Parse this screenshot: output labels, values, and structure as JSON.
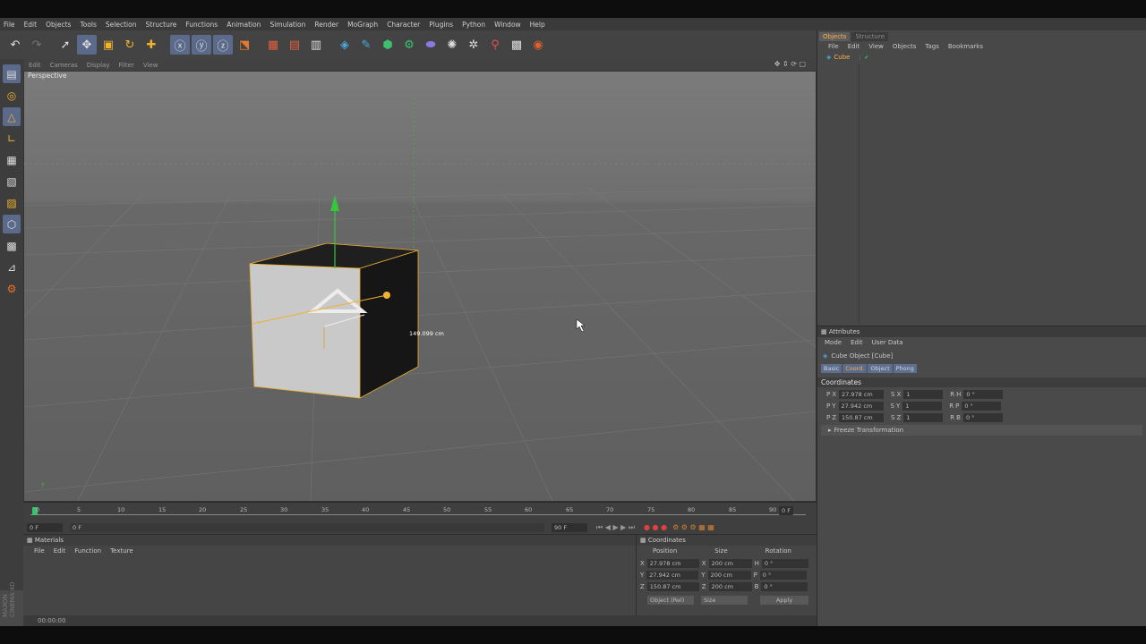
{
  "menu": [
    "File",
    "Edit",
    "Objects",
    "Tools",
    "Selection",
    "Structure",
    "Functions",
    "Animation",
    "Simulation",
    "Render",
    "MoGraph",
    "Character",
    "Plugins",
    "Python",
    "Window",
    "Help"
  ],
  "viewport": {
    "menu": [
      "Edit",
      "Cameras",
      "Display",
      "Filter",
      "View"
    ],
    "label": "Perspective",
    "measure": "149.099 cm"
  },
  "timeline": {
    "ticks": [
      "0",
      "5",
      "10",
      "15",
      "20",
      "25",
      "30",
      "35",
      "40",
      "45",
      "50",
      "55",
      "60",
      "65",
      "70",
      "75",
      "80",
      "85",
      "90"
    ],
    "end_field": "0 F",
    "start_field": "0 F",
    "slider_field": "0 F",
    "max_field": "90 F"
  },
  "materials": {
    "title": "Materials",
    "menu": [
      "File",
      "Edit",
      "Function",
      "Texture"
    ]
  },
  "coordinates": {
    "title": "Coordinates",
    "headers": [
      "Position",
      "Size",
      "Rotation"
    ],
    "rows": [
      {
        "axis": "X",
        "pos": "27.978 cm",
        "size_axis": "X",
        "size": "200 cm",
        "rot_axis": "H",
        "rot": "0 °"
      },
      {
        "axis": "Y",
        "pos": "27.942 cm",
        "size_axis": "Y",
        "size": "200 cm",
        "rot_axis": "P",
        "rot": "0 °"
      },
      {
        "axis": "Z",
        "pos": "150.87 cm",
        "size_axis": "Z",
        "size": "200 cm",
        "rot_axis": "B",
        "rot": "0 °"
      }
    ],
    "mode_select": "Object (Rel)",
    "size_select": "Size",
    "apply": "Apply"
  },
  "status": "00:00:00",
  "object_manager": {
    "tabs": [
      "Objects",
      "Structure"
    ],
    "menu": [
      "File",
      "Edit",
      "View",
      "Objects",
      "Tags",
      "Bookmarks"
    ],
    "objects": [
      {
        "name": "Cube"
      }
    ]
  },
  "attributes": {
    "title": "Attributes",
    "menu": [
      "Mode",
      "Edit",
      "User Data"
    ],
    "object_title": "Cube Object [Cube]",
    "tabs": [
      "Basic",
      "Coord.",
      "Object",
      "Phong"
    ],
    "section": "Coordinates",
    "rows": [
      {
        "p": "P",
        "axis": "X",
        "pos": "27.978 cm",
        "s": "S",
        "s_axis": "X",
        "scale": "1",
        "r": "R",
        "r_axis": "H",
        "rot": "0 °"
      },
      {
        "p": "P",
        "axis": "Y",
        "pos": "27.942 cm",
        "s": "S",
        "s_axis": "Y",
        "scale": "1",
        "r": "R",
        "r_axis": "P",
        "rot": "0 °"
      },
      {
        "p": "P",
        "axis": "Z",
        "pos": "150.87 cm",
        "s": "S",
        "s_axis": "Z",
        "scale": "1",
        "r": "R",
        "r_axis": "B",
        "rot": "0 °"
      }
    ],
    "freeze": "Freeze Transformation"
  },
  "brand": "MAXON CINEMA 4D",
  "colors": {
    "accent": "#ffb24a",
    "selection": "#5b6a8a",
    "axis_y": "#35c83a",
    "axis_x": "#d64040"
  }
}
